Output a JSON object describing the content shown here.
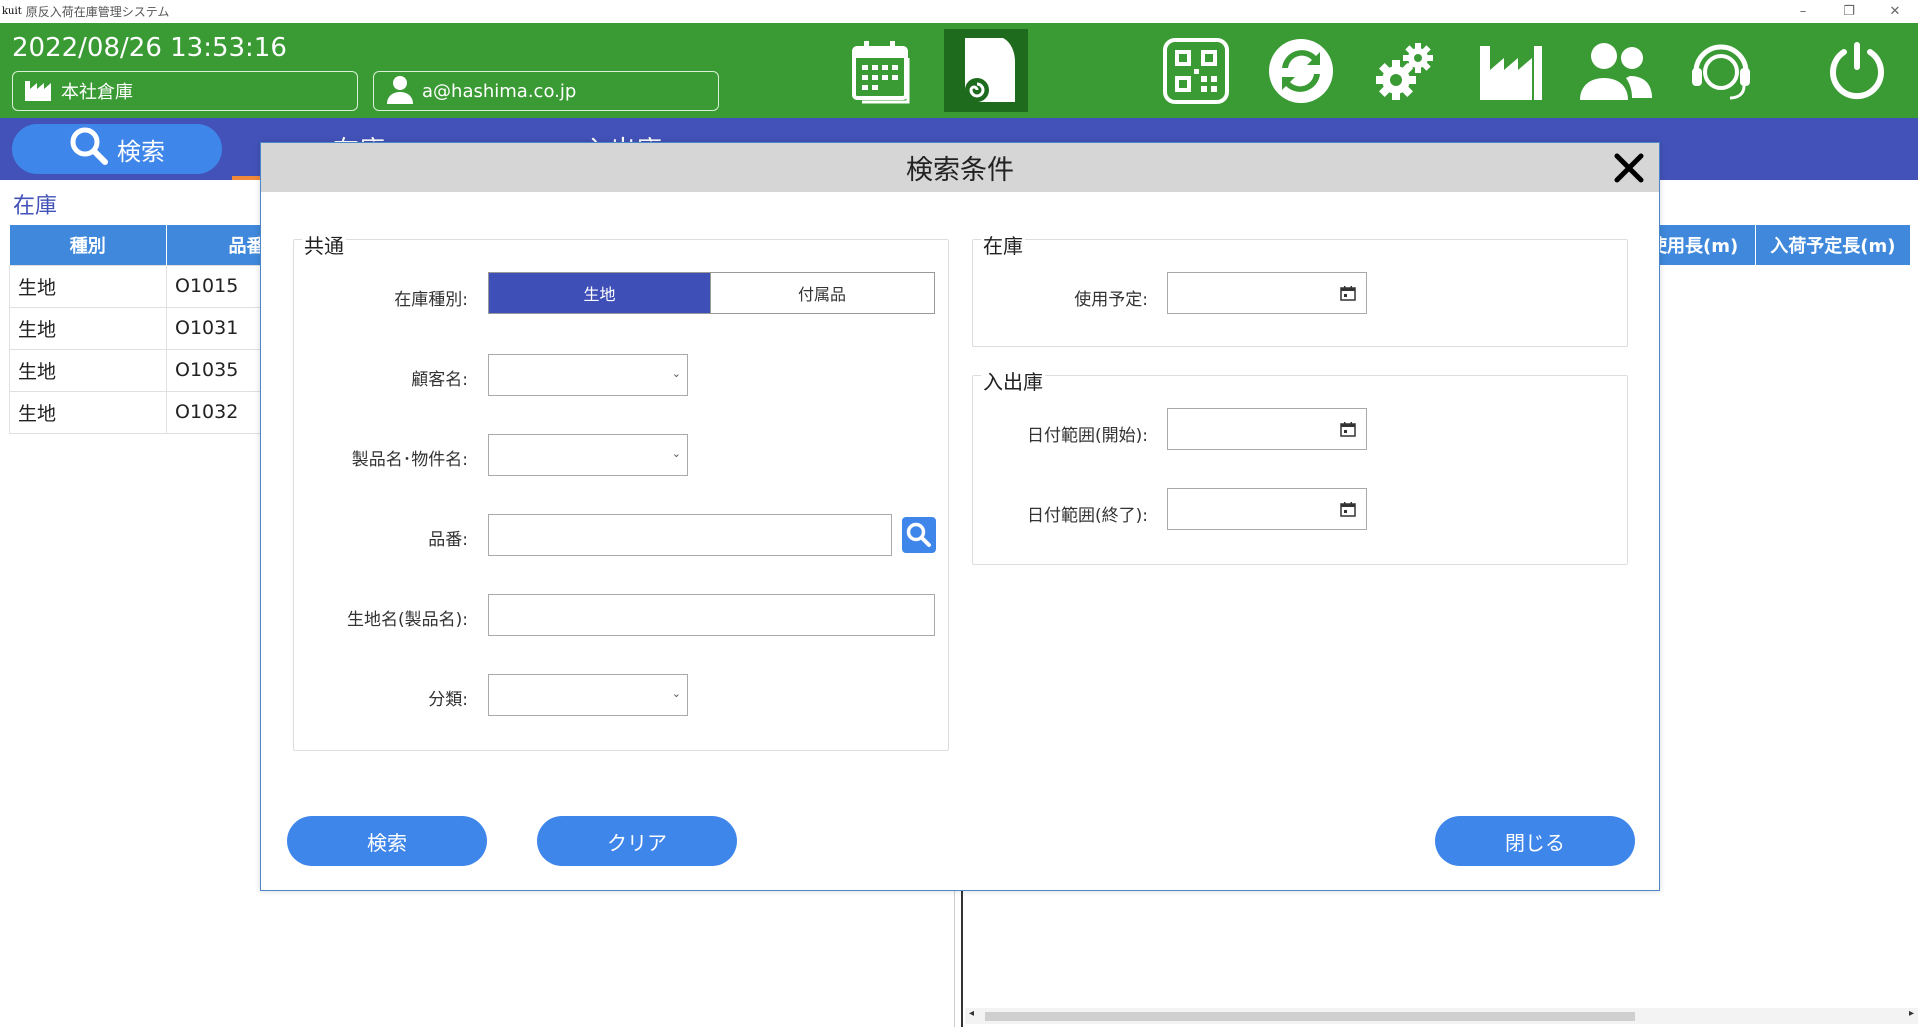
{
  "window": {
    "logo_text": "kuit",
    "title": "原反入荷在庫管理システム",
    "controls": [
      "–",
      "❐",
      "✕"
    ]
  },
  "header": {
    "datetime": "2022/08/26 13:53:16",
    "warehouse": "本社倉庫",
    "user_email": "a@hashima.co.jp",
    "icons": [
      "calendar-icon",
      "fabric-roll-icon",
      "qr-code-icon",
      "sync-icon",
      "settings-icon",
      "factory-icon",
      "users-icon",
      "support-headset-icon",
      "power-icon"
    ],
    "bg_color": "#3a9b35"
  },
  "tabs": {
    "search_label": "検索",
    "items": [
      "在庫",
      "入出庫"
    ],
    "bg_color": "#4352b8",
    "active_underline_color": "#f08a3a"
  },
  "main": {
    "section_title": "在庫",
    "columns": [
      "種別",
      "品番"
    ],
    "rows": [
      [
        "生地",
        "O1015"
      ],
      [
        "生地",
        "O1031"
      ],
      [
        "生地",
        "O1035"
      ],
      [
        "生地",
        "O1032"
      ]
    ],
    "right_columns": [
      "使用長(m)",
      "入荷予定長(m)"
    ]
  },
  "modal": {
    "title": "検索条件",
    "common": {
      "legend": "共通",
      "stock_type_label": "在庫種別:",
      "stock_type_options": [
        "生地",
        "付属品"
      ],
      "stock_type_selected": "生地",
      "customer_label": "顧客名:",
      "product_label": "製品名･物件名:",
      "part_no_label": "品番:",
      "fabric_name_label": "生地名(製品名):",
      "category_label": "分類:"
    },
    "stock": {
      "legend": "在庫",
      "planned_use_label": "使用予定:"
    },
    "inout": {
      "legend": "入出庫",
      "date_start_label": "日付範囲(開始):",
      "date_end_label": "日付範囲(終了):"
    },
    "buttons": {
      "search": "検索",
      "clear": "クリア",
      "close": "閉じる"
    },
    "accent_color": "#3f86ea"
  }
}
